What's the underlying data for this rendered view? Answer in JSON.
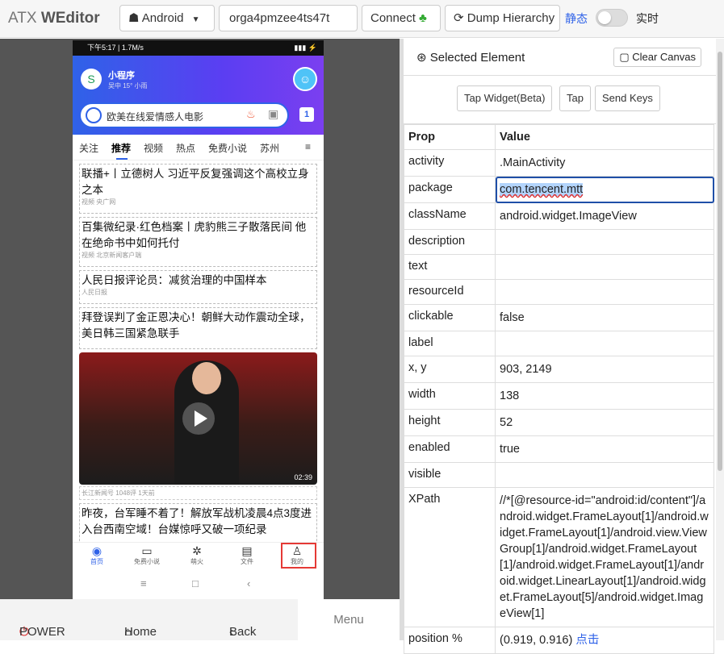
{
  "toolbar": {
    "brand_a": "ATX ",
    "brand_b": "WEditor",
    "platform": "Android",
    "platform_icon": "android-icon",
    "device_serial": "orga4pmzee4ts47t",
    "connect": "Connect",
    "dump": "Dump Hierarchy",
    "mode_static": "静态",
    "mode_live": "实时"
  },
  "phone": {
    "status_left": "下午5:17 | 1.7M/s",
    "miniprogram_title": "小程序",
    "miniprogram_sub": "吴中 15° 小雨",
    "search_text": "欧美在线爱情感人电影",
    "tab_count": "1",
    "tabs": [
      "关注",
      "推荐",
      "视频",
      "热点",
      "免费小说",
      "苏州"
    ],
    "news": [
      {
        "title": "联播+丨立德树人 习近平反复强调这个高校立身之本",
        "source": "视频 央广网"
      },
      {
        "title": "百集微纪录·红色档案丨虎豹熊三子散落民间 他在绝命书中如何托付",
        "source": "视频 北京新闻客户端"
      },
      {
        "title": "人民日报评论员：减贫治理的中国样本",
        "source": "人民日报"
      },
      {
        "title": "拜登误判了金正恩决心！朝鲜大动作震动全球，美日韩三国紧急联手",
        "source": ""
      }
    ],
    "video_duration": "02:39",
    "video_meta": "长江新闻号 1048评 1天前",
    "news5": "昨夜，台军睡不着了！解放军战机凌晨4点3度进入台西南空域！台媒惊呼又破一项纪录",
    "bottom_nav": [
      "首页",
      "免费小说",
      "萌火",
      "文件",
      "我的"
    ]
  },
  "controls": {
    "power": "POWER",
    "home": "Home",
    "back": "Back",
    "menu": "Menu"
  },
  "inspector": {
    "title": "Selected Element",
    "clear": "Clear Canvas",
    "tap_widget": "Tap Widget(Beta)",
    "tap": "Tap",
    "send_keys": "Send Keys",
    "col_prop": "Prop",
    "col_value": "Value",
    "rows": [
      {
        "k": "activity",
        "v": ".MainActivity"
      },
      {
        "k": "package",
        "v": "com.tencent.mtt"
      },
      {
        "k": "className",
        "v": "android.widget.ImageView"
      },
      {
        "k": "description",
        "v": ""
      },
      {
        "k": "text",
        "v": ""
      },
      {
        "k": "resourceId",
        "v": ""
      },
      {
        "k": "clickable",
        "v": "false"
      },
      {
        "k": "label",
        "v": ""
      },
      {
        "k": "x, y",
        "v": "903, 2149"
      },
      {
        "k": "width",
        "v": "138"
      },
      {
        "k": "height",
        "v": "52"
      },
      {
        "k": "enabled",
        "v": "true"
      },
      {
        "k": "visible",
        "v": ""
      },
      {
        "k": "XPath",
        "v": "//*[@resource-id=\"android:id/content\"]/android.widget.FrameLayout[1]/android.widget.FrameLayout[1]/android.view.ViewGroup[1]/android.widget.FrameLayout[1]/android.widget.FrameLayout[1]/android.widget.LinearLayout[1]/android.widget.FrameLayout[5]/android.widget.ImageView[1]"
      },
      {
        "k": "position %",
        "v": "(0.919, 0.916)"
      }
    ],
    "position_link": "点击"
  }
}
